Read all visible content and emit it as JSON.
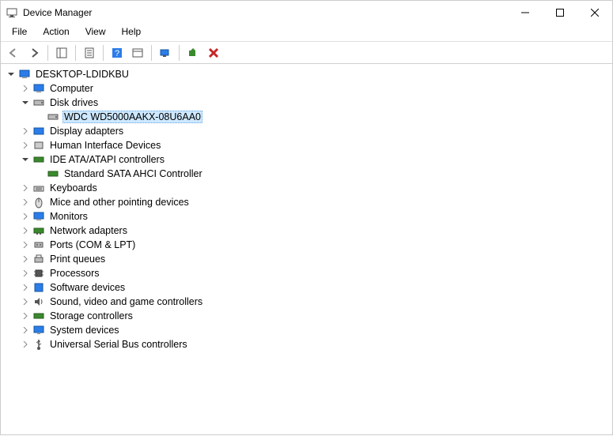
{
  "window": {
    "title": "Device Manager"
  },
  "menu": {
    "file": "File",
    "action": "Action",
    "view": "View",
    "help": "Help"
  },
  "tree": {
    "root": "DESKTOP-LDIDKBU",
    "computer": "Computer",
    "disk_drives": "Disk drives",
    "wdc": "WDC WD5000AAKX-08U6AA0",
    "display_adapters": "Display adapters",
    "hid": "Human Interface Devices",
    "ide": "IDE ATA/ATAPI controllers",
    "sata": "Standard SATA AHCI Controller",
    "keyboards": "Keyboards",
    "mice": "Mice and other pointing devices",
    "monitors": "Monitors",
    "network": "Network adapters",
    "ports": "Ports (COM & LPT)",
    "print_queues": "Print queues",
    "processors": "Processors",
    "software_devices": "Software devices",
    "sound": "Sound, video and game controllers",
    "storage": "Storage controllers",
    "system_devices": "System devices",
    "usb": "Universal Serial Bus controllers"
  }
}
